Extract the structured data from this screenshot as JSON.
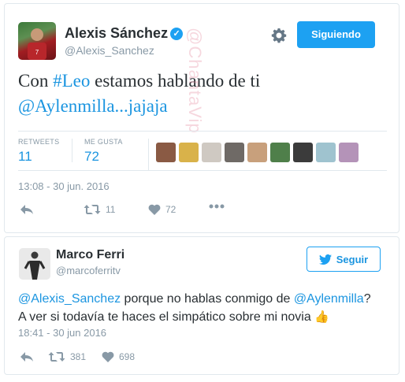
{
  "tweet": {
    "author_name": "Alexis Sánchez",
    "author_handle": "@Alexis_Sanchez",
    "follow_state_label": "Siguiendo",
    "text_prefix": "Con ",
    "hashtag": "#Leo",
    "text_middle": " estamos hablando de ti",
    "mention": "@Aylenmilla...jajaja",
    "retweets_label": "RETWEETS",
    "retweets_value": "11",
    "likes_label": "ME GUSTA",
    "likes_value": "72",
    "timestamp": "13:08 - 30 jun. 2016",
    "retweet_count": "11",
    "like_count": "72",
    "likers": [
      {
        "color": "#8a5a44"
      },
      {
        "color": "#d9b24a"
      },
      {
        "color": "#cfc9c2"
      },
      {
        "color": "#6f6a66"
      },
      {
        "color": "#c8a07c"
      },
      {
        "color": "#4f7f4a"
      },
      {
        "color": "#3b3b3b"
      },
      {
        "color": "#9fc3cf"
      },
      {
        "color": "#b493b8"
      }
    ]
  },
  "reply": {
    "author_name": "Marco Ferri",
    "author_handle": "@marcoferritv",
    "follow_label": "Seguir",
    "mention1": "@Alexis_Sanchez",
    "text1": " porque no hablas conmigo de ",
    "mention2": "@Aylenmilla",
    "text2": "?",
    "line2": "A ver si todavía te haces el simpático sobre mi novia",
    "emoji": "👍",
    "timestamp": "18:41 - 30 jun 2016",
    "retweet_count": "381",
    "like_count": "698"
  },
  "watermark": "@ChantaVip",
  "colors": {
    "accent": "#1da1f2",
    "link": "#1b95e0",
    "muted": "#8899a6"
  }
}
